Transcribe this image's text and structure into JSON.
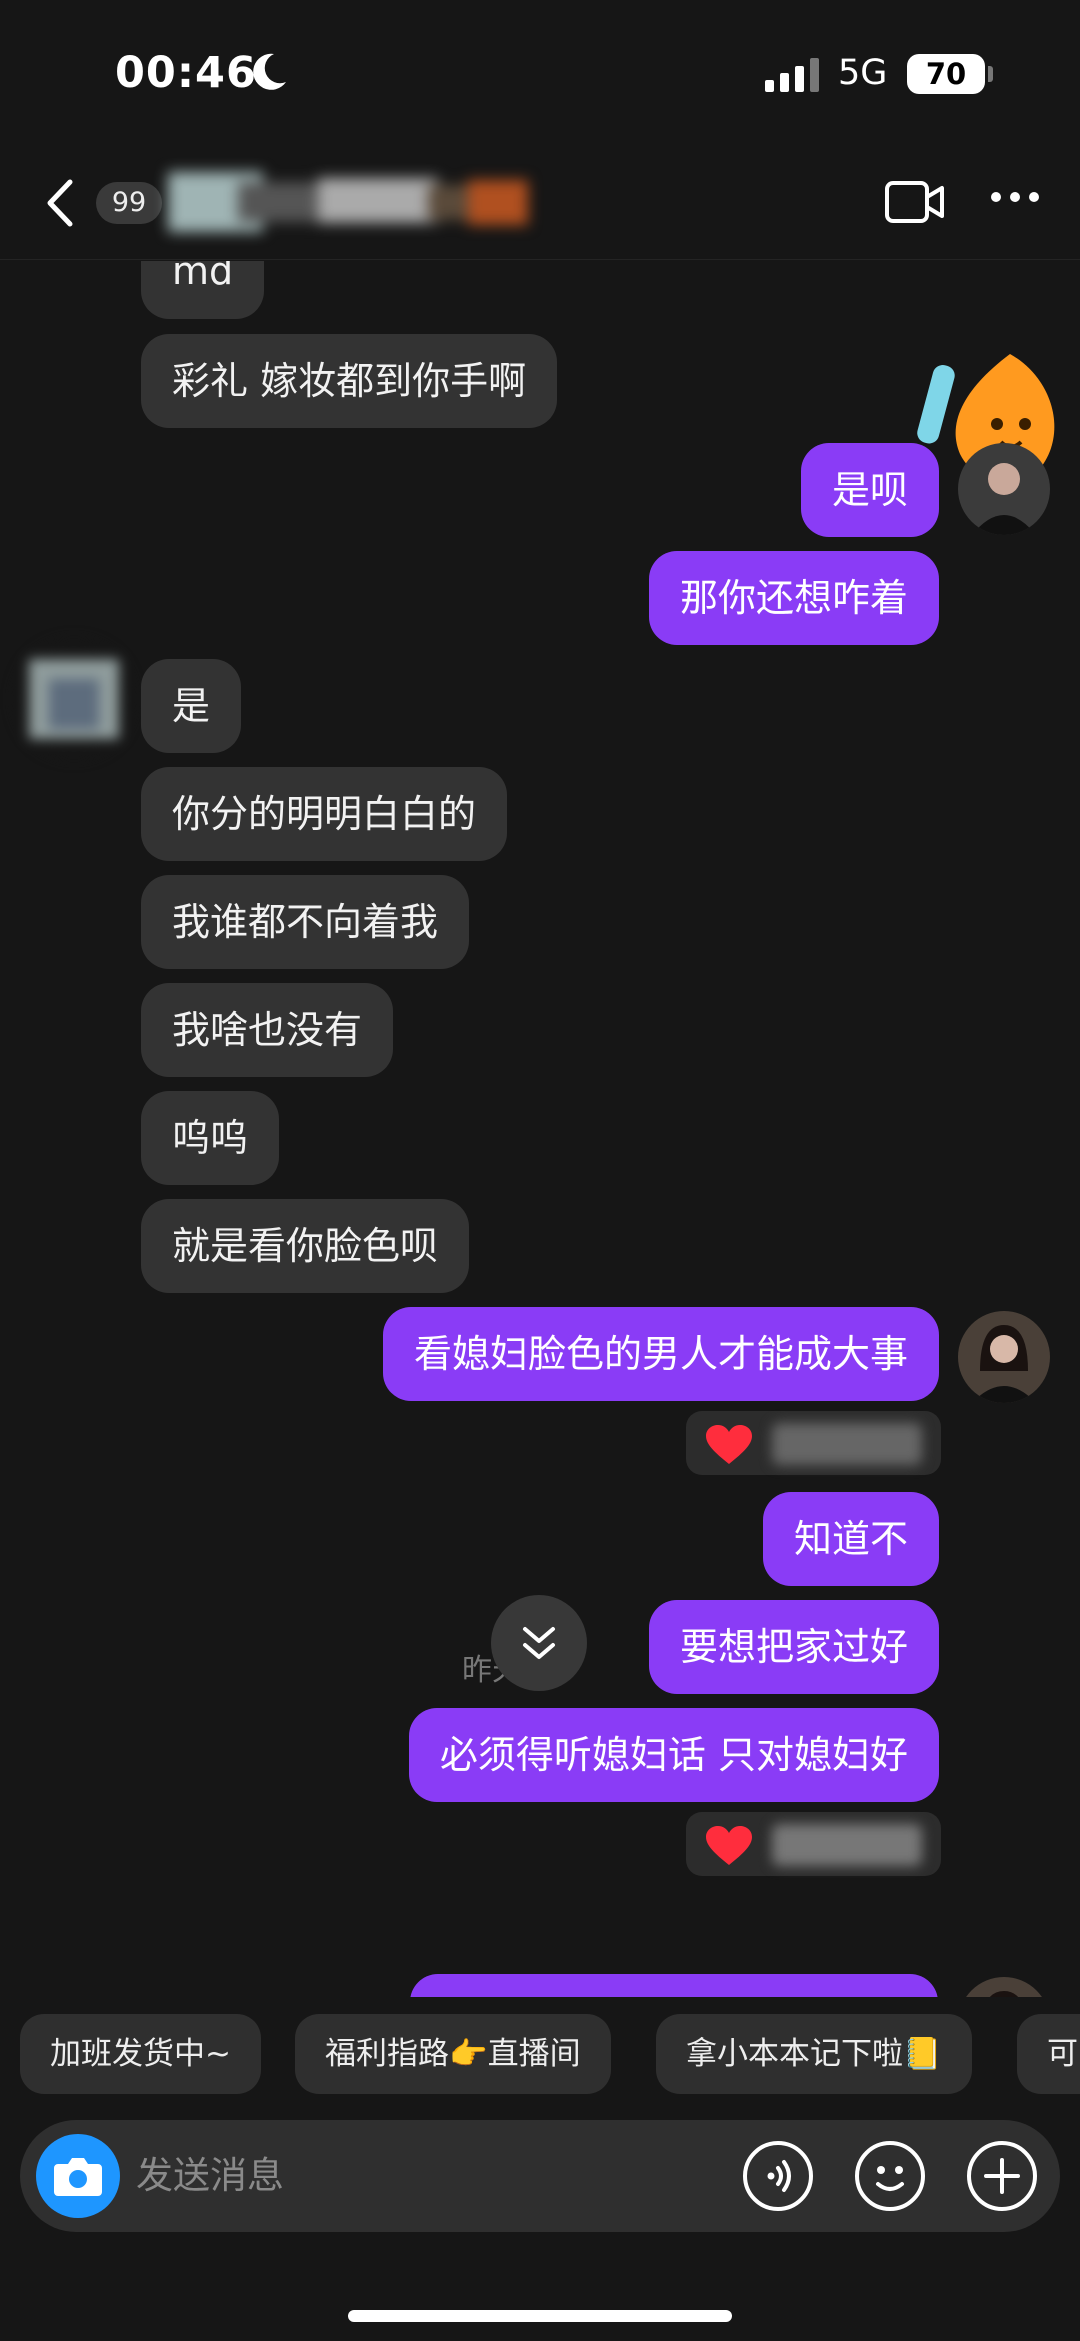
{
  "status_bar": {
    "time": "00:46",
    "network": "5G",
    "battery": "70"
  },
  "header": {
    "unread_badge": "99"
  },
  "messages": [
    {
      "side": "in",
      "text": "md"
    },
    {
      "side": "in",
      "text": "彩礼  嫁妆都到你手啊"
    },
    {
      "side": "out",
      "text": "是呗"
    },
    {
      "side": "out",
      "text": "那你还想咋着"
    },
    {
      "side": "in",
      "text": "是"
    },
    {
      "side": "in",
      "text": "你分的明明白白的"
    },
    {
      "side": "in",
      "text": "我谁都不向着我"
    },
    {
      "side": "in",
      "text": "我啥也没有"
    },
    {
      "side": "in",
      "text": "呜呜"
    },
    {
      "side": "in",
      "text": "就是看你脸色呗"
    },
    {
      "side": "out",
      "text": "看媳妇脸色的男人才能成大事"
    },
    {
      "side": "out",
      "text": "知道不"
    },
    {
      "side": "out",
      "text": "要想把家过好"
    },
    {
      "side": "out",
      "text": "必须得听媳妇话 只对媳妇好"
    }
  ],
  "timestamp": "昨天 59",
  "quick_replies": [
    "加班发货中~",
    "福利指路👉直播间",
    "拿小本本记下啦📒",
    "可"
  ],
  "input": {
    "placeholder": "发送消息"
  },
  "colors": {
    "outgoing": "#8a3cf6",
    "incoming": "#333333",
    "background": "#161616"
  }
}
